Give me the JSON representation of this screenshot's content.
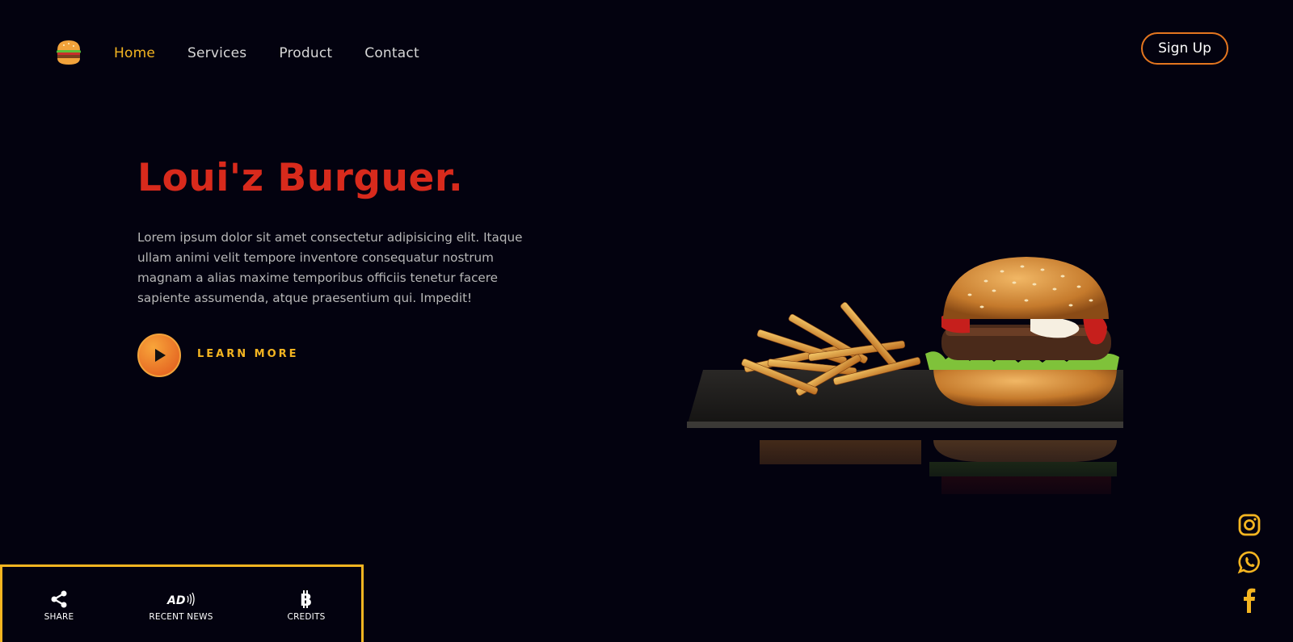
{
  "header": {
    "logo_icon": "burger-icon",
    "nav": [
      {
        "label": "Home",
        "active": true
      },
      {
        "label": "Services",
        "active": false
      },
      {
        "label": "Product",
        "active": false
      },
      {
        "label": "Contact",
        "active": false
      }
    ],
    "signup_label": "Sign Up"
  },
  "hero": {
    "title": "Loui'z Burguer.",
    "description": "Lorem ipsum dolor sit amet consectetur adipisicing elit. Itaque ullam animi velit tempore inventore consequatur nostrum magnam a alias maxime temporibus officiis tenetur facere sapiente assumenda, atque praesentium qui. Impedit!",
    "cta_label": "LEARN MORE",
    "image": "burger-and-fries-photo"
  },
  "social": [
    "instagram-icon",
    "whatsapp-icon",
    "facebook-icon"
  ],
  "bottom_bar": [
    {
      "label": "SHARE",
      "icon": "share-icon"
    },
    {
      "label": "RECENT NEWS",
      "icon": "ad-icon"
    },
    {
      "label": "CREDITS",
      "icon": "bitcoin-icon"
    }
  ],
  "colors": {
    "background": "#03020f",
    "accent": "#f4b521",
    "title": "#d82a1c",
    "orange": "#e4761f"
  }
}
